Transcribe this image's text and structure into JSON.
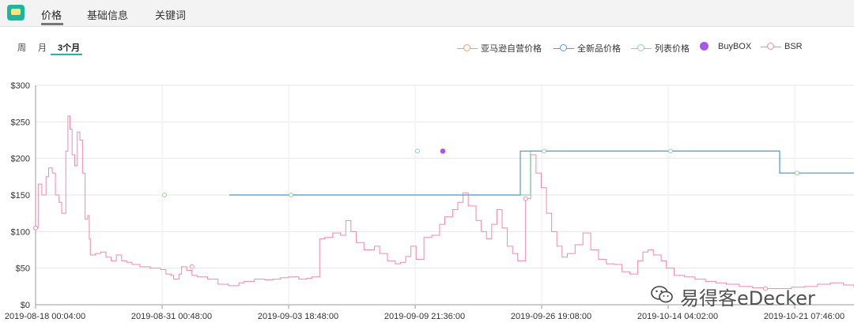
{
  "tabs": [
    {
      "label": "价格",
      "active": true
    },
    {
      "label": "基础信息",
      "active": false
    },
    {
      "label": "关键词",
      "active": false
    }
  ],
  "ranges": [
    {
      "label": "周",
      "active": false
    },
    {
      "label": "月",
      "active": false
    },
    {
      "label": "3个月",
      "active": true
    }
  ],
  "watermark": "易得客eDecker",
  "colors": {
    "amazon": "#e8a36a",
    "new": "#5b9bd5",
    "list": "#8fd4a6",
    "buybox": "#a855f7",
    "bsr": "#f28aa8",
    "accent": "#1fb6a6"
  },
  "chart_data": {
    "type": "line",
    "y_axis": {
      "min": 0,
      "max": 300,
      "ticks": [
        "$0",
        "$50",
        "$100",
        "$150",
        "$200",
        "$250",
        "$300"
      ]
    },
    "x_ticks": [
      "2019-08-18 00:04:00",
      "2019-08-31 00:48:00",
      "2019-09-03 18:48:00",
      "2019-09-09 21:36:00",
      "2019-09-26 19:08:00",
      "2019-10-14 04:02:00",
      "2019-10-21 07:46:00"
    ],
    "grid": true,
    "legend_position": "top-right",
    "series": [
      {
        "name": "亚马逊自营价格",
        "color": "#e8a36a",
        "values": []
      },
      {
        "name": "全新品价格",
        "color": "#5b9bd5",
        "values": [
          [
            1.5,
            150
          ],
          [
            3.8,
            150
          ],
          [
            3.8,
            210
          ],
          [
            5.85,
            210
          ],
          [
            5.85,
            180
          ],
          [
            7.0,
            180
          ]
        ]
      },
      {
        "name": "列表价格",
        "color": "#8fd4a6",
        "values": [
          [
            1.5,
            150
          ],
          [
            3.88,
            150
          ],
          [
            3.88,
            210
          ],
          [
            5.85,
            210
          ],
          [
            5.85,
            180
          ],
          [
            7.0,
            180
          ]
        ]
      },
      {
        "name": "BuyBOX",
        "color": "#a855f7",
        "values": [
          [
            3.2,
            210
          ]
        ]
      },
      {
        "name": "BSR",
        "color": "#f28aa8",
        "values": [
          [
            0.0,
            105
          ],
          [
            0.05,
            165
          ],
          [
            0.12,
            150
          ],
          [
            0.2,
            175
          ],
          [
            0.25,
            187
          ],
          [
            0.32,
            180
          ],
          [
            0.38,
            150
          ],
          [
            0.45,
            140
          ],
          [
            0.5,
            125
          ],
          [
            0.58,
            210
          ],
          [
            0.62,
            258
          ],
          [
            0.66,
            240
          ],
          [
            0.7,
            205
          ],
          [
            0.75,
            190
          ],
          [
            0.8,
            236
          ],
          [
            0.85,
            225
          ],
          [
            0.9,
            180
          ],
          [
            0.95,
            117
          ],
          [
            1.0,
            122
          ],
          [
            1.03,
            90
          ],
          [
            1.05,
            68
          ],
          [
            1.15,
            70
          ],
          [
            1.25,
            72
          ],
          [
            1.35,
            65
          ],
          [
            1.45,
            60
          ],
          [
            1.55,
            68
          ],
          [
            1.65,
            60
          ],
          [
            1.75,
            58
          ],
          [
            1.85,
            55
          ],
          [
            2.0,
            52
          ],
          [
            2.2,
            50
          ],
          [
            2.4,
            48
          ],
          [
            2.5,
            42
          ],
          [
            2.6,
            40
          ],
          [
            2.65,
            35
          ],
          [
            2.75,
            42
          ],
          [
            2.8,
            52
          ],
          [
            2.9,
            47
          ],
          [
            3.0,
            40
          ],
          [
            3.1,
            38
          ],
          [
            3.3,
            35
          ],
          [
            3.5,
            28
          ],
          [
            3.7,
            26
          ],
          [
            3.9,
            30
          ],
          [
            4.0,
            32
          ],
          [
            4.2,
            35
          ],
          [
            4.4,
            34
          ],
          [
            4.55,
            35
          ],
          [
            4.7,
            37
          ],
          [
            4.85,
            38
          ],
          [
            5.05,
            35
          ],
          [
            5.2,
            36
          ],
          [
            5.3,
            38
          ],
          [
            5.45,
            90
          ],
          [
            5.55,
            92
          ],
          [
            5.7,
            98
          ],
          [
            5.85,
            95
          ],
          [
            5.95,
            115
          ],
          [
            6.05,
            100
          ],
          [
            6.15,
            85
          ],
          [
            6.3,
            75
          ],
          [
            6.5,
            80
          ],
          [
            6.6,
            70
          ],
          [
            6.75,
            60
          ],
          [
            6.9,
            56
          ],
          [
            7.0,
            58
          ],
          [
            7.1,
            66
          ],
          [
            7.2,
            80
          ],
          [
            7.3,
            62
          ],
          [
            7.45,
            92
          ],
          [
            7.6,
            95
          ],
          [
            7.75,
            110
          ],
          [
            7.85,
            120
          ],
          [
            8.0,
            130
          ],
          [
            8.1,
            140
          ],
          [
            8.2,
            153
          ],
          [
            8.3,
            135
          ],
          [
            8.45,
            115
          ],
          [
            8.55,
            100
          ],
          [
            8.65,
            90
          ],
          [
            8.75,
            110
          ],
          [
            8.85,
            130
          ],
          [
            8.95,
            105
          ],
          [
            9.05,
            80
          ],
          [
            9.15,
            70
          ],
          [
            9.25,
            60
          ],
          [
            9.4,
            145
          ],
          [
            9.5,
            205
          ],
          [
            9.6,
            180
          ],
          [
            9.7,
            160
          ],
          [
            9.8,
            125
          ],
          [
            9.9,
            100
          ],
          [
            10.0,
            80
          ],
          [
            10.1,
            65
          ],
          [
            10.2,
            70
          ],
          [
            10.35,
            82
          ],
          [
            10.5,
            98
          ],
          [
            10.65,
            75
          ],
          [
            10.8,
            62
          ],
          [
            10.95,
            56
          ],
          [
            11.1,
            55
          ],
          [
            11.25,
            45
          ],
          [
            11.4,
            42
          ],
          [
            11.55,
            60
          ],
          [
            11.65,
            72
          ],
          [
            11.75,
            75
          ],
          [
            11.85,
            68
          ],
          [
            12.0,
            60
          ],
          [
            12.1,
            50
          ],
          [
            12.25,
            40
          ],
          [
            12.45,
            38
          ],
          [
            12.65,
            35
          ],
          [
            12.85,
            32
          ],
          [
            13.05,
            30
          ],
          [
            13.25,
            28
          ],
          [
            13.5,
            25
          ],
          [
            13.75,
            23
          ],
          [
            14.0,
            22
          ],
          [
            14.25,
            22
          ],
          [
            14.5,
            24
          ],
          [
            14.75,
            25
          ],
          [
            15.0,
            28
          ],
          [
            15.25,
            30
          ],
          [
            15.5,
            27
          ],
          [
            15.7,
            24
          ]
        ]
      }
    ]
  }
}
